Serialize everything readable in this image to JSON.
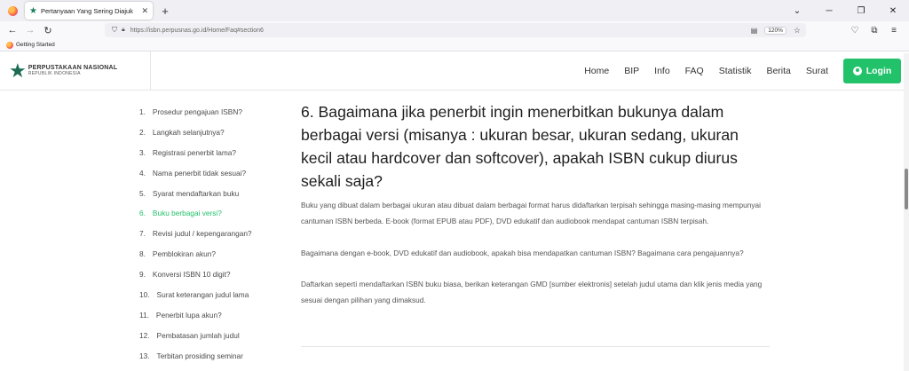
{
  "browser": {
    "tab_title": "Pertanyaan Yang Sering Diajuk",
    "tab_close": "✕",
    "new_tab": "+",
    "url": "https://isbn.perpusnas.go.id/Home/Faq#section6",
    "zoom": "120%",
    "bookmark": "Getting Started",
    "icons": [
      "back-icon",
      "forward-icon",
      "reload-icon",
      "shield-icon",
      "lock-icon",
      "reader-view-icon",
      "star-icon",
      "pocket-icon",
      "extensions-icon",
      "menu-icon"
    ]
  },
  "site": {
    "logo_line1": "PERPUSTAKAAN NASIONAL",
    "logo_line2": "REPUBLIK INDONESIA",
    "nav": [
      "Home",
      "BIP",
      "Info",
      "FAQ",
      "Statistik",
      "Berita",
      "Surat"
    ],
    "login": "Login",
    "accent_color": "#22c26b"
  },
  "faq_list": [
    {
      "num": "1.",
      "label": "Prosedur pengajuan ISBN?"
    },
    {
      "num": "2.",
      "label": "Langkah selanjutnya?"
    },
    {
      "num": "3.",
      "label": "Registrasi penerbit lama?"
    },
    {
      "num": "4.",
      "label": "Nama penerbit tidak sesuai?"
    },
    {
      "num": "5.",
      "label": "Syarat mendaftarkan buku"
    },
    {
      "num": "6.",
      "label": "Buku berbagai versi?"
    },
    {
      "num": "7.",
      "label": "Revisi judul / kepengarangan?"
    },
    {
      "num": "8.",
      "label": "Pemblokiran akun?"
    },
    {
      "num": "9.",
      "label": "Konversi ISBN 10 digit?"
    },
    {
      "num": "10.",
      "label": "Surat keterangan judul lama"
    },
    {
      "num": "11.",
      "label": "Penerbit lupa akun?"
    },
    {
      "num": "12.",
      "label": "Pembatasan jumlah judul"
    },
    {
      "num": "13.",
      "label": "Terbitan prosiding seminar"
    }
  ],
  "active_index": 5,
  "content": {
    "question": "6. Bagaimana jika penerbit ingin menerbitkan bukunya dalam berbagai versi (misanya : ukuran besar, ukuran sedang, ukuran kecil atau hardcover dan softcover), apakah ISBN cukup diurus sekali saja?",
    "paragraphs": [
      "Buku yang dibuat dalam berbagai ukuran atau dibuat dalam berbagai format harus didaftarkan terpisah sehingga masing-masing mempunyai cantuman ISBN berbeda. E-book (format EPUB atau PDF), DVD edukatif dan audiobook mendapat cantuman ISBN terpisah.",
      "Bagaimana dengan e-book, DVD edukatif dan audiobook, apakah bisa mendapatkan cantuman ISBN? Bagaimana cara pengajuannya?",
      "Daftarkan seperti mendaftarkan ISBN buku biasa, berikan keterangan GMD [sumber elektronis] setelah judul utama dan klik jenis media yang sesuai dengan pilihan yang dimaksud."
    ]
  }
}
